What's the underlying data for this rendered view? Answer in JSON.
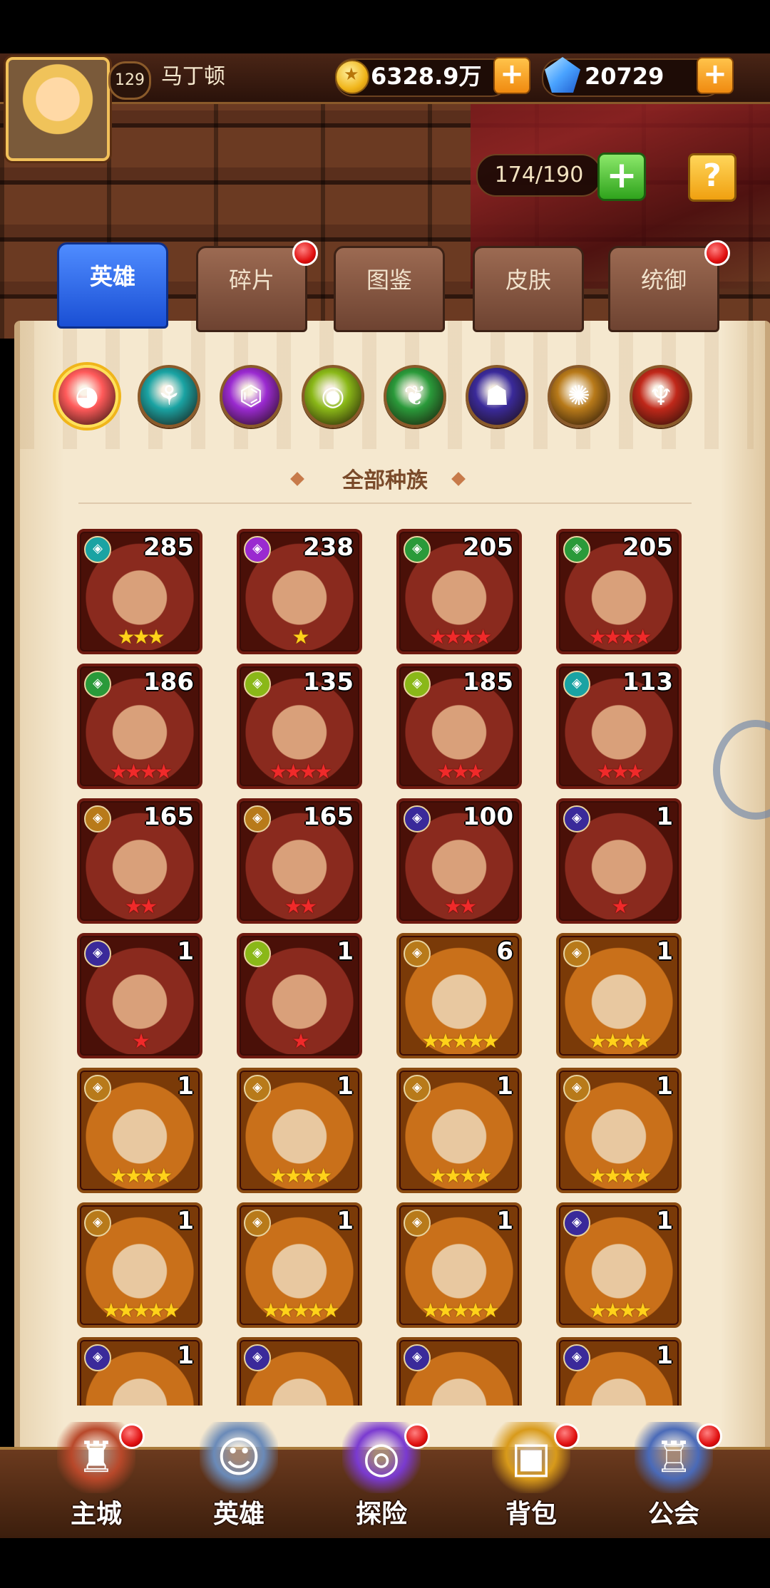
{
  "header": {
    "level": "129",
    "player_name": "马丁顿",
    "gold": "6328.9万",
    "gems": "20729",
    "plus": "+"
  },
  "capacity": {
    "text": "174/190",
    "plus": "+",
    "help": "?"
  },
  "tabs": [
    {
      "label": "英雄",
      "active": true,
      "dot": false
    },
    {
      "label": "碎片",
      "active": false,
      "dot": true
    },
    {
      "label": "图鉴",
      "active": false,
      "dot": false
    },
    {
      "label": "皮肤",
      "active": false,
      "dot": false
    },
    {
      "label": "统御",
      "active": false,
      "dot": true
    }
  ],
  "race_filters": [
    {
      "name": "all-races-icon",
      "color": "#ff5a5a",
      "glyph": "◕",
      "selected": true
    },
    {
      "name": "tide-race-icon",
      "color": "#1aa3a3",
      "glyph": "⚘",
      "selected": false
    },
    {
      "name": "shadow-race-icon",
      "color": "#9a2ad0",
      "glyph": "⌬",
      "selected": false
    },
    {
      "name": "eye-race-icon",
      "color": "#8ab818",
      "glyph": "◉",
      "selected": false
    },
    {
      "name": "nature-race-icon",
      "color": "#2a9a3a",
      "glyph": "❦",
      "selected": false
    },
    {
      "name": "demon-race-icon",
      "color": "#3a2a9a",
      "glyph": "☗",
      "selected": false
    },
    {
      "name": "light-race-icon",
      "color": "#b87a1a",
      "glyph": "✺",
      "selected": false
    },
    {
      "name": "dark-race-icon",
      "color": "#c0281a",
      "glyph": "♆",
      "selected": false
    }
  ],
  "filter_label": "全部种族",
  "heroes": [
    {
      "level": "285",
      "race_color": "#1aa3a3",
      "stars": 3,
      "star_type": "gold",
      "frame": "red"
    },
    {
      "level": "238",
      "race_color": "#9a2ad0",
      "stars": 1,
      "star_type": "gold",
      "frame": "red"
    },
    {
      "level": "205",
      "race_color": "#2a9a3a",
      "stars": 4,
      "star_type": "red",
      "frame": "red"
    },
    {
      "level": "205",
      "race_color": "#2a9a3a",
      "stars": 4,
      "star_type": "red",
      "frame": "red"
    },
    {
      "level": "186",
      "race_color": "#2a9a3a",
      "stars": 4,
      "star_type": "red",
      "frame": "red"
    },
    {
      "level": "135",
      "race_color": "#8ab818",
      "stars": 4,
      "star_type": "red",
      "frame": "red"
    },
    {
      "level": "185",
      "race_color": "#8ab818",
      "stars": 3,
      "star_type": "red",
      "frame": "red"
    },
    {
      "level": "113",
      "race_color": "#1aa3a3",
      "stars": 3,
      "star_type": "red",
      "frame": "red"
    },
    {
      "level": "165",
      "race_color": "#b87a1a",
      "stars": 2,
      "star_type": "red",
      "frame": "red"
    },
    {
      "level": "165",
      "race_color": "#b87a1a",
      "stars": 2,
      "star_type": "red",
      "frame": "red"
    },
    {
      "level": "100",
      "race_color": "#3a2a9a",
      "stars": 2,
      "star_type": "red",
      "frame": "red"
    },
    {
      "level": "1",
      "race_color": "#3a2a9a",
      "stars": 1,
      "star_type": "red",
      "frame": "red"
    },
    {
      "level": "1",
      "race_color": "#3a2a9a",
      "stars": 1,
      "star_type": "red",
      "frame": "red"
    },
    {
      "level": "1",
      "race_color": "#8ab818",
      "stars": 1,
      "star_type": "red",
      "frame": "red"
    },
    {
      "level": "6",
      "race_color": "#b87a1a",
      "stars": 5,
      "star_type": "gold",
      "frame": "gold"
    },
    {
      "level": "1",
      "race_color": "#b87a1a",
      "stars": 4,
      "star_type": "gold",
      "frame": "gold"
    },
    {
      "level": "1",
      "race_color": "#b87a1a",
      "stars": 4,
      "star_type": "gold",
      "frame": "gold"
    },
    {
      "level": "1",
      "race_color": "#b87a1a",
      "stars": 4,
      "star_type": "gold",
      "frame": "gold"
    },
    {
      "level": "1",
      "race_color": "#b87a1a",
      "stars": 4,
      "star_type": "gold",
      "frame": "gold"
    },
    {
      "level": "1",
      "race_color": "#b87a1a",
      "stars": 4,
      "star_type": "gold",
      "frame": "gold"
    },
    {
      "level": "1",
      "race_color": "#b87a1a",
      "stars": 5,
      "star_type": "gold",
      "frame": "gold"
    },
    {
      "level": "1",
      "race_color": "#b87a1a",
      "stars": 5,
      "star_type": "gold",
      "frame": "gold"
    },
    {
      "level": "1",
      "race_color": "#b87a1a",
      "stars": 5,
      "star_type": "gold",
      "frame": "gold"
    },
    {
      "level": "1",
      "race_color": "#3a2a9a",
      "stars": 4,
      "star_type": "gold",
      "frame": "gold"
    },
    {
      "level": "1",
      "race_color": "#3a2a9a",
      "stars": 0,
      "star_type": "gold",
      "frame": "gold"
    },
    {
      "level": "",
      "race_color": "#3a2a9a",
      "stars": 0,
      "star_type": "gold",
      "frame": "gold"
    },
    {
      "level": "",
      "race_color": "#3a2a9a",
      "stars": 0,
      "star_type": "gold",
      "frame": "gold"
    },
    {
      "level": "1",
      "race_color": "#3a2a9a",
      "stars": 0,
      "star_type": "gold",
      "frame": "gold"
    }
  ],
  "bottom_nav": [
    {
      "label": "主城",
      "icon": "castle-icon",
      "color": "#b8482a",
      "glyph": "♜",
      "dot": true
    },
    {
      "label": "英雄",
      "icon": "hero-portrait-icon",
      "color": "#6a8ab8",
      "glyph": "☺",
      "dot": false
    },
    {
      "label": "探险",
      "icon": "portal-icon",
      "color": "#7a3ad0",
      "glyph": "◎",
      "dot": true
    },
    {
      "label": "背包",
      "icon": "backpack-icon",
      "color": "#d89a1a",
      "glyph": "▣",
      "dot": true
    },
    {
      "label": "公会",
      "icon": "guild-tower-icon",
      "color": "#4a6ab8",
      "glyph": "♖",
      "dot": true
    }
  ]
}
